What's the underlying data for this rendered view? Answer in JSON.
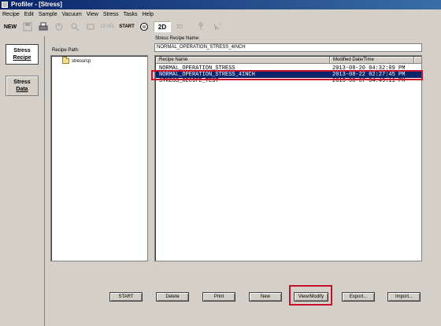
{
  "window": {
    "title": "Profiler - [Stress]"
  },
  "menu": [
    "Recipe",
    "Edit",
    "Sample",
    "Vacuum",
    "View",
    "Stress",
    "Tasks",
    "Help"
  ],
  "toolbar": {
    "new_label": "NEW",
    "level_label": "LEVEL",
    "start_label": "START",
    "mode_2d_label": "2D",
    "mode_3d_label": "3D",
    "icons": [
      "save-icon",
      "print-icon",
      "measure-icon",
      "search-icon",
      "scan-icon",
      "laser-icon",
      "tool-icon",
      "help-icon"
    ]
  },
  "sidebar": {
    "stress_recipe": {
      "line1": "Stress",
      "line2": "Recipe"
    },
    "stress_data": {
      "line1": "Stress",
      "line2": "Data"
    }
  },
  "recipe_path": {
    "label": "Recipe Path:",
    "folder": "stressrcp"
  },
  "recipe_name": {
    "label": "Stress Recipe Name:",
    "value": "NORMAL_OPERATION_STRESS_4INCH"
  },
  "table": {
    "columns": [
      "Recipe Name",
      "Modified Date/Time"
    ],
    "rows": [
      {
        "name": "NORMAL_OPERATION_STRESS",
        "date": "2013-08-20 04:32:09 PM",
        "selected": false
      },
      {
        "name": "NORMAL_OPERATION_STRESS_4INCH",
        "date": "2013-08-22 02:27:45 PM",
        "selected": true
      },
      {
        "name": "STRESS_RECIPE_TEST",
        "date": "2013-08-07 04:49:11 PM",
        "selected": false
      }
    ]
  },
  "buttons": {
    "start": "START",
    "delete": "Delete",
    "print": "Print",
    "new": "New",
    "view_modify": "View/Modify",
    "export": "Export...",
    "import": "Import..."
  },
  "colors": {
    "selection": "#0a246a",
    "highlight_box": "#c8102e",
    "window_bg": "#d4d0c8"
  }
}
